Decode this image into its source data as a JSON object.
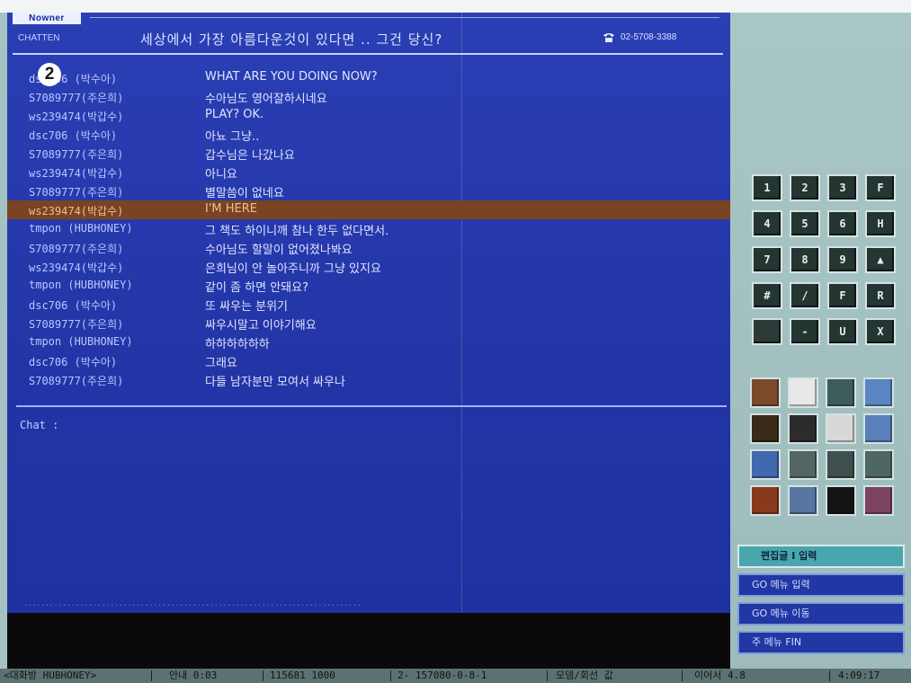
{
  "header": {
    "logo": "Nowner",
    "brand_sub": "CHATTEN",
    "title": "세상에서 가장 아름다운것이 있다면 .. 그건 당신?",
    "phone": "02-5708-3388",
    "badge": "2"
  },
  "chat": {
    "messages": [
      {
        "user": "dsc706  (박수아)",
        "text": "WHAT ARE YOU DOING  NOW?"
      },
      {
        "user": "S7089777(주은희)",
        "text": "수아님도 영어잘하시네요"
      },
      {
        "user": "ws239474(박갑수)",
        "text": "PLAY? OK."
      },
      {
        "user": "dsc706  (박수아)",
        "text": "아뇨 그냥.."
      },
      {
        "user": "S7089777(주은희)",
        "text": "갑수님은 나갔나요"
      },
      {
        "user": "ws239474(박갑수)",
        "text": "아니요"
      },
      {
        "user": "S7089777(주은희)",
        "text": "별말씀이 없네요"
      },
      {
        "user": "ws239474(박갑수)",
        "text": "I'M HERE",
        "highlight": true
      },
      {
        "user": "tmpon   (HUBHONEY)",
        "text": "그 책도 하이니깨 참나 한두 없다면서."
      },
      {
        "user": "S7089777(주은희)",
        "text": "수아님도 할말이 없어졌나봐요"
      },
      {
        "user": "ws239474(박갑수)",
        "text": "은희님이 안 놀아주니까 그냥 있지요"
      },
      {
        "user": "tmpon   (HUBHONEY)",
        "text": "같이 좀 하면 안돼요?"
      },
      {
        "user": "dsc706  (박수아)",
        "text": "또 싸우는 분위기"
      },
      {
        "user": "S7089777(주은희)",
        "text": "싸우시말고 이야기해요"
      },
      {
        "user": "tmpon   (HUBHONEY)",
        "text": "하하하하하하"
      },
      {
        "user": "dsc706  (박수아)",
        "text": "그래요"
      },
      {
        "user": "S7089777(주은희)",
        "text": "다들 남자분만 모여서 싸우나"
      }
    ],
    "prompt": "Chat :",
    "bottom_dots": "··············································································"
  },
  "keypad": {
    "keys": [
      "1",
      "2",
      "3",
      "F",
      "4",
      "5",
      "6",
      "H",
      "7",
      "8",
      "9",
      "▲",
      "#",
      "/",
      "F",
      "R",
      "",
      "-",
      "U",
      "X"
    ]
  },
  "icons": [
    {
      "name": "book-icon",
      "color": "#7a4a2a"
    },
    {
      "name": "mail-icon",
      "color": "#e8e8e8"
    },
    {
      "name": "refresh-icon",
      "color": "#3e5d5a"
    },
    {
      "name": "monitor-icon",
      "color": "#5b84c2"
    },
    {
      "name": "clock-icon",
      "color": "#3a2a1a"
    },
    {
      "name": "save-icon",
      "color": "#2c2c2c"
    },
    {
      "name": "document-icon",
      "color": "#d8d8d8"
    },
    {
      "name": "globe-icon",
      "color": "#5b7fb8"
    },
    {
      "name": "window-icon",
      "color": "#4169b0"
    },
    {
      "name": "keyboard-icon",
      "color": "#546664"
    },
    {
      "name": "plug-icon",
      "color": "#3f4f4d"
    },
    {
      "name": "sliders-icon",
      "color": "#4d6764"
    },
    {
      "name": "firework-icon",
      "color": "#8a3a1c"
    },
    {
      "name": "camera-icon",
      "color": "#5675a0"
    },
    {
      "name": "dark-screen-icon",
      "color": "#141414"
    },
    {
      "name": "flag-icon",
      "color": "#7d4460"
    }
  ],
  "menu": [
    "편집글 I 입력",
    "GO 메뉴 입력",
    "GO 메뉴 이동",
    "주 메뉴 FIN"
  ],
  "status": {
    "seg1": "<대화방 HUBHONEY>",
    "seg2": "안내 0:03",
    "seg3": "115681 1000",
    "seg4": "2- 157080-0-8-1",
    "seg5": "모뎀/회선 값",
    "seg6": "이어서 4.8",
    "seg7": "4:09:17"
  }
}
